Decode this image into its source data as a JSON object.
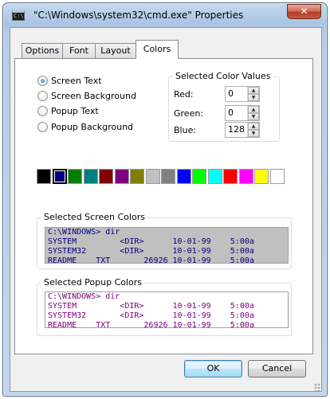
{
  "window": {
    "title": "\"C:\\Windows\\system32\\cmd.exe\" Properties",
    "close_label": "✕"
  },
  "tabs": [
    {
      "label": "Options"
    },
    {
      "label": "Font"
    },
    {
      "label": "Layout"
    },
    {
      "label": "Colors",
      "active": true
    }
  ],
  "target_options": [
    {
      "label": "Screen Text",
      "checked": true
    },
    {
      "label": "Screen Background",
      "checked": false
    },
    {
      "label": "Popup Text",
      "checked": false
    },
    {
      "label": "Popup Background",
      "checked": false
    }
  ],
  "color_values": {
    "legend": "Selected Color Values",
    "red_label": "Red:",
    "red_value": "0",
    "green_label": "Green:",
    "green_value": "0",
    "blue_label": "Blue:",
    "blue_value": "128"
  },
  "palette": [
    "#000000",
    "#000080",
    "#008000",
    "#008080",
    "#800000",
    "#800080",
    "#808000",
    "#c0c0c0",
    "#808080",
    "#0000ff",
    "#00ff00",
    "#00ffff",
    "#ff0000",
    "#ff00ff",
    "#ffff00",
    "#ffffff"
  ],
  "palette_selected_index": 1,
  "screen_colors": {
    "legend": "Selected Screen Colors",
    "text_color": "#000080",
    "background": "#c0c0c0",
    "lines": [
      "C:\\WINDOWS> dir",
      "SYSTEM         <DIR>      10-01-99    5:00a",
      "SYSTEM32       <DIR>      10-01-99    5:00a",
      "README    TXT       26926 10-01-99    5:00a"
    ]
  },
  "popup_colors": {
    "legend": "Selected Popup Colors",
    "text_color": "#800080",
    "background": "#ffffff",
    "lines": [
      "C:\\WINDOWS> dir",
      "SYSTEM         <DIR>      10-01-99    5:00a",
      "SYSTEM32       <DIR>      10-01-99    5:00a",
      "README    TXT       26926 10-01-99    5:00a"
    ]
  },
  "buttons": {
    "ok": "OK",
    "cancel": "Cancel"
  }
}
